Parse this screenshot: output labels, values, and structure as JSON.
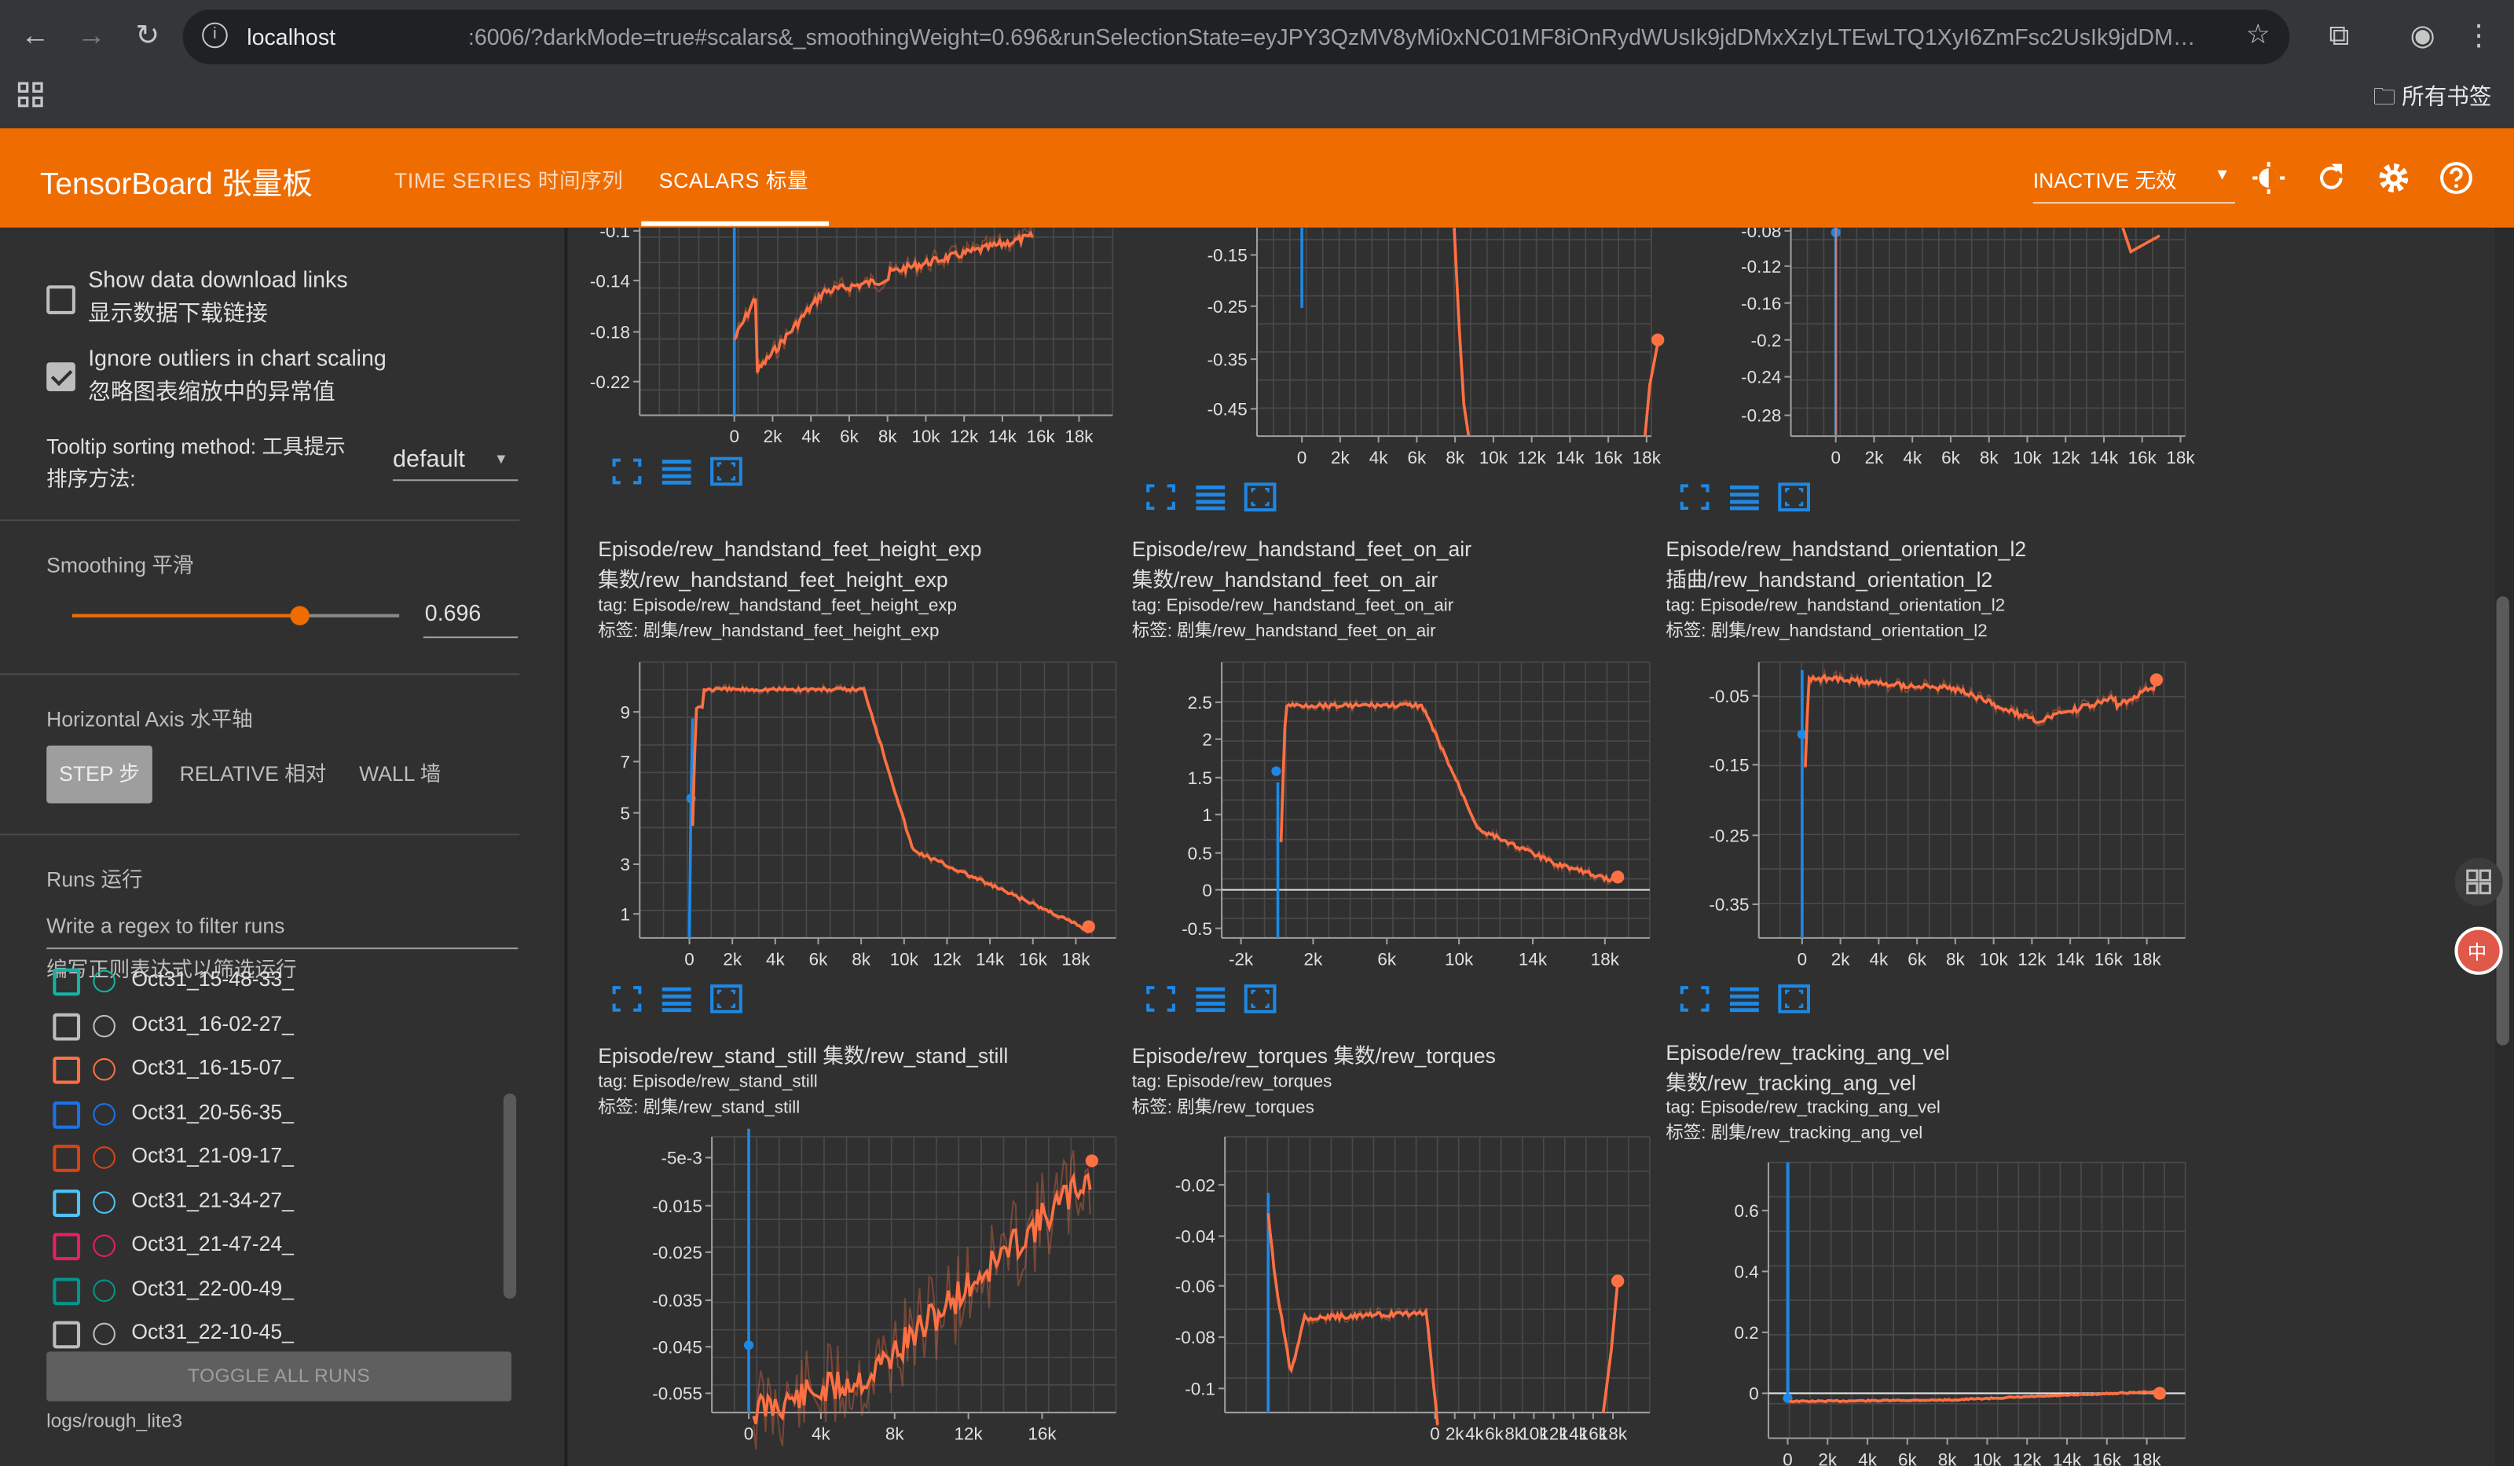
{
  "browser": {
    "url_host": "localhost",
    "url_rest": ":6006/?darkMode=true#scalars&_smoothingWeight=0.696&runSelectionState=eyJPY3QzMV8yMi0xNC01MF8iOnRydWUsIk9jdDMxXzIyLTEwLTQ1XyI6ZmFsc2UsIk9jdDMxXzIyLTAwLTQ5XyI...",
    "bookmarks": "所有书签"
  },
  "header": {
    "logo": "TensorBoard 张量板",
    "tabs": [
      {
        "label": "TIME SERIES 时间序列"
      },
      {
        "label": "SCALARS 标量"
      }
    ],
    "inactive": "INACTIVE 无效"
  },
  "sidebar": {
    "show_download": "Show data download links",
    "show_download_cn": "显示数据下载链接",
    "ignore_outliers": "Ignore outliers in chart scaling",
    "ignore_outliers_cn": "忽略图表缩放中的异常值",
    "tooltip_label": "Tooltip sorting method: 工具提示",
    "tooltip_label2": "排序方法:",
    "tooltip_value": "default",
    "smoothing_label": "Smoothing 平滑",
    "smoothing_value": "0.696",
    "haxis_label": "Horizontal Axis 水平轴",
    "haxis_options": [
      "STEP 步",
      "RELATIVE 相对",
      "WALL 墙"
    ],
    "runs_label": "Runs 运行",
    "runs_filter_placeholder": "Write a regex to filter runs",
    "runs_filter_hint": "编写正则表达式以筛选运行",
    "runs": [
      {
        "name": "Oct31_15-48-33_",
        "color": "#12b5a2",
        "checked": false
      },
      {
        "name": "Oct31_16-02-27_",
        "color": "#bdbdbd",
        "checked": false
      },
      {
        "name": "Oct31_16-15-07_",
        "color": "#ff7043",
        "checked": false
      },
      {
        "name": "Oct31_20-56-35_",
        "color": "#1a73e8",
        "checked": false
      },
      {
        "name": "Oct31_21-09-17_",
        "color": "#d84315",
        "checked": false
      },
      {
        "name": "Oct31_21-34-27_",
        "color": "#4fc3f7",
        "checked": false
      },
      {
        "name": "Oct31_21-47-24_",
        "color": "#e91e63",
        "checked": false
      },
      {
        "name": "Oct31_22-00-49_",
        "color": "#009688",
        "checked": false
      },
      {
        "name": "Oct31_22-10-45_",
        "color": "#bdbdbd",
        "checked": false
      }
    ],
    "toggle_all": "TOGGLE ALL RUNS",
    "logdir": "logs/rough_lite3"
  },
  "cards": [
    {
      "id": "r0c0",
      "title": [],
      "tags": [],
      "yticks": [
        "-0.1",
        "-0.14",
        "-0.18",
        "-0.22"
      ],
      "xticks": [
        "0",
        "2k",
        "4k",
        "6k",
        "8k",
        "10k",
        "12k",
        "14k",
        "16k",
        "18k"
      ]
    },
    {
      "id": "r0c1",
      "title": [],
      "tags": [],
      "yticks": [
        "-0.15",
        "-0.25",
        "-0.35",
        "-0.45"
      ],
      "xticks": [
        "0",
        "2k",
        "4k",
        "6k",
        "8k",
        "10k",
        "12k",
        "14k",
        "16k",
        "18k"
      ]
    },
    {
      "id": "r0c2",
      "title": [],
      "tags": [],
      "yticks": [
        "-0.08",
        "-0.12",
        "-0.16",
        "-0.2",
        "-0.24",
        "-0.28"
      ],
      "xticks": [
        "0",
        "2k",
        "4k",
        "6k",
        "8k",
        "10k",
        "12k",
        "14k",
        "16k",
        "18k"
      ]
    },
    {
      "id": "r1c0",
      "title": [
        "Episode/rew_handstand_feet_height_exp",
        "集数/rew_handstand_feet_height_exp"
      ],
      "tags": [
        "tag: Episode/rew_handstand_feet_height_exp",
        "标签: 剧集/rew_handstand_feet_height_exp"
      ],
      "yticks": [
        "9",
        "7",
        "5",
        "3",
        "1"
      ],
      "xticks": [
        "0",
        "2k",
        "4k",
        "6k",
        "8k",
        "10k",
        "12k",
        "14k",
        "16k",
        "18k"
      ]
    },
    {
      "id": "r1c1",
      "title": [
        "Episode/rew_handstand_feet_on_air",
        "集数/rew_handstand_feet_on_air"
      ],
      "tags": [
        "tag: Episode/rew_handstand_feet_on_air",
        "标签: 剧集/rew_handstand_feet_on_air"
      ],
      "yticks": [
        "2.5",
        "2",
        "1.5",
        "1",
        "0.5",
        "0",
        "-0.5"
      ],
      "xticks": [
        "-2k",
        "2k",
        "6k",
        "10k",
        "14k",
        "18k"
      ]
    },
    {
      "id": "r1c2",
      "title": [
        "Episode/rew_handstand_orientation_l2",
        "插曲/rew_handstand_orientation_l2"
      ],
      "tags": [
        "tag: Episode/rew_handstand_orientation_l2",
        "标签: 剧集/rew_handstand_orientation_l2"
      ],
      "yticks": [
        "-0.05",
        "-0.15",
        "-0.25",
        "-0.35"
      ],
      "xticks": [
        "0",
        "2k",
        "4k",
        "6k",
        "8k",
        "10k",
        "12k",
        "14k",
        "16k",
        "18k"
      ]
    },
    {
      "id": "r2c0",
      "title": [
        "Episode/rew_stand_still 集数/rew_stand_still"
      ],
      "tags": [
        "tag: Episode/rew_stand_still",
        "标签: 剧集/rew_stand_still"
      ],
      "yticks": [
        "-5e-3",
        "-0.015",
        "-0.025",
        "-0.035",
        "-0.045",
        "-0.055"
      ],
      "xticks": [
        "0",
        "4k",
        "8k",
        "12k",
        "16k"
      ]
    },
    {
      "id": "r2c1",
      "title": [
        "Episode/rew_torques 集数/rew_torques"
      ],
      "tags": [
        "tag: Episode/rew_torques",
        "标签: 剧集/rew_torques"
      ],
      "yticks": [
        "-0.02",
        "-0.04",
        "-0.06",
        "-0.08",
        "-0.1"
      ],
      "xticks": [
        "0",
        "2k",
        "4k",
        "6k",
        "8k",
        "10k",
        "12k",
        "14k",
        "16k",
        "18k"
      ]
    },
    {
      "id": "r2c2",
      "title": [
        "Episode/rew_tracking_ang_vel",
        "集数/rew_tracking_ang_vel"
      ],
      "tags": [
        "tag: Episode/rew_tracking_ang_vel",
        "标签: 剧集/rew_tracking_ang_vel"
      ],
      "yticks": [
        "0.6",
        "0.4",
        "0.2",
        "0"
      ],
      "xticks": [
        "0",
        "2k",
        "4k",
        "6k",
        "8k",
        "10k",
        "12k",
        "14k",
        "16k",
        "18k"
      ]
    }
  ]
}
